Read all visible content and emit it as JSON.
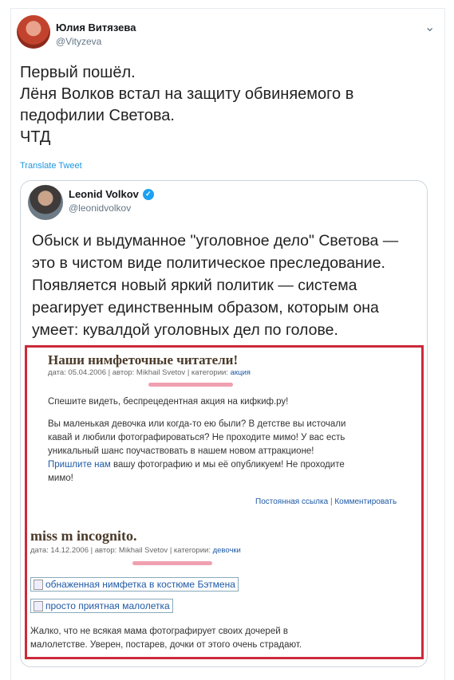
{
  "tweet": {
    "author_name": "Юлия Витязева",
    "author_handle": "@Vityzeva",
    "lines": [
      "Первый пошёл.",
      "Лёня Волков встал на защиту обвиняемого в",
      "педофилии Светова.",
      "ЧТД"
    ],
    "translate_label": "Translate Tweet"
  },
  "quoted": {
    "author_name": "Leonid Volkov",
    "author_handle": "@leonidvolkov",
    "lines": [
      "Обыск и выдуманное \"уголовное дело\" Светова —",
      "это в чистом виде политическое преследование.",
      "Появляется новый яркий политик — система",
      "реагирует единственным образом, которым она",
      "умеет: кувалдой уголовных дел по голове."
    ]
  },
  "blog": {
    "post1": {
      "title": "Наши нимфеточные читатели!",
      "meta_prefix": "дата: 05.04.2006 | автор: Mikhail Svetov | категории: ",
      "category": "акция",
      "p1": "Спешите видеть, беспрецедентная акция на кифкиф.ру!",
      "p2_lines": [
        "Вы маленькая девочка или когда-то ею были? В детстве вы источали",
        "кавай и любили фотографироваться? Не проходите мимо! У вас есть",
        "уникальный шанс поучаствовать в нашем новом аттракционе!"
      ],
      "p2_link": "Пришлите нам",
      "p2_after_link": " вашу фотографию и мы её опубликуем! Не проходите",
      "p2_last": "мимо!",
      "permalink": "Постоянная ссылка",
      "separator": " | ",
      "comment": "Комментировать"
    },
    "post2": {
      "title": "miss m incognito.",
      "meta_prefix": "дата: 14.12.2006 | автор: Mikhail Svetov | категории: ",
      "category": "девочки",
      "image1": "обнаженная нимфетка в костюме Бэтмена",
      "image2": "просто приятная малолетка",
      "text_lines": [
        "Жалко, что не всякая мама фотографирует своих дочерей в",
        "малолетстве. Уверен, постарев, дочки от этого очень страдают."
      ]
    }
  },
  "colors": {
    "highlight_border": "#cc2a3a",
    "link": "#1b95e0",
    "verified": "#1da1f2"
  },
  "icons": {
    "menu": "chevron-down-icon",
    "verified": "verified-badge-icon"
  }
}
